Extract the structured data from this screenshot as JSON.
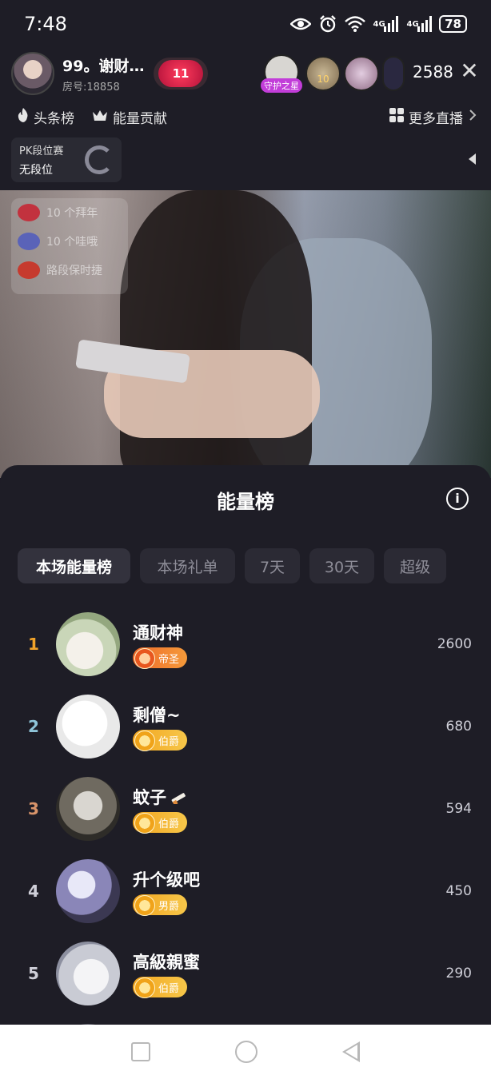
{
  "status_bar": {
    "time": "7:48",
    "network_1": "4G",
    "network_2": "4G",
    "battery": "78"
  },
  "live_header": {
    "host_name": "99。谢财…",
    "room_number": "房号:18858",
    "like_count": "11",
    "guard_tag": "守护之星",
    "viewer_badge": "10",
    "viewer_count": "2588",
    "close_glyph": "✕"
  },
  "sub_nav": {
    "headlines": "头条榜",
    "energy_contribution": "能量贡献",
    "more_live": "更多直播"
  },
  "pk": {
    "title": "PK段位赛",
    "rank": "无段位"
  },
  "stream_overlay": {
    "items": [
      "10 个拜年",
      "10 个哇哦",
      "路段保时捷"
    ]
  },
  "sheet": {
    "title": "能量榜",
    "info_glyph": "i",
    "tabs": [
      {
        "label": "本场能量榜",
        "active": true
      },
      {
        "label": "本场礼单",
        "active": false
      },
      {
        "label": "7天",
        "active": false
      },
      {
        "label": "30天",
        "active": false
      },
      {
        "label": "超级",
        "active": false
      }
    ],
    "ranking": [
      {
        "rank": "1",
        "name": "通财神",
        "badge": "帝圣",
        "score": "2600",
        "rank_color": "#f2a32a"
      },
      {
        "rank": "2",
        "name": "剩僧~",
        "badge": "伯爵",
        "score": "680",
        "rank_color": "#8fc4d8"
      },
      {
        "rank": "3",
        "name": "蚊子",
        "badge": "伯爵",
        "score": "594",
        "rank_color": "#d9946a"
      },
      {
        "rank": "4",
        "name": "升个级吧",
        "badge": "男爵",
        "score": "450",
        "rank_color": "#cfcfd8"
      },
      {
        "rank": "5",
        "name": "高級親蜜",
        "badge": "伯爵",
        "score": "290",
        "rank_color": "#cfcfd8"
      }
    ]
  },
  "icons": {
    "eye": "eye-icon",
    "alarm": "alarm-icon",
    "wifi": "wifi-icon",
    "flame": "flame-icon",
    "crown": "crown-icon",
    "grid": "grid-icon"
  }
}
